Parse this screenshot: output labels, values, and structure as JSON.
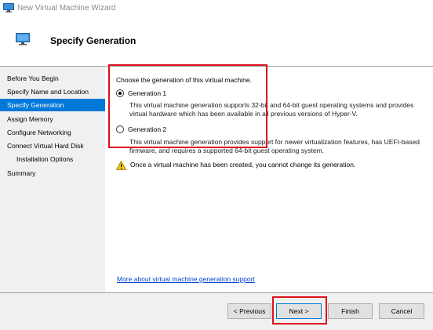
{
  "window": {
    "title": "New Virtual Machine Wizard",
    "icon": "monitor-icon"
  },
  "header": {
    "title": "Specify Generation",
    "icon": "monitor-icon"
  },
  "nav": {
    "items": [
      {
        "label": "Before You Begin",
        "active": false
      },
      {
        "label": "Specify Name and Location",
        "active": false
      },
      {
        "label": "Specify Generation",
        "active": true
      },
      {
        "label": "Assign Memory",
        "active": false
      },
      {
        "label": "Configure Networking",
        "active": false
      },
      {
        "label": "Connect Virtual Hard Disk",
        "active": false
      },
      {
        "label": "Installation Options",
        "active": false,
        "sub": true
      },
      {
        "label": "Summary",
        "active": false
      }
    ]
  },
  "content": {
    "prompt": "Choose the generation of this virtual machine.",
    "options": [
      {
        "label": "Generation 1",
        "selected": true,
        "description": "This virtual machine generation supports 32-bit and 64-bit guest operating systems and provides virtual hardware which has been available in all previous versions of Hyper-V."
      },
      {
        "label": "Generation 2",
        "selected": false,
        "description": "This virtual machine generation provides support for newer virtualization features, has UEFI-based firmware, and requires a supported 64-bit guest operating system."
      }
    ],
    "warning": "Once a virtual machine has been created, you cannot change its generation.",
    "warning_icon": "warning-icon",
    "more_link": "More about virtual machine generation support"
  },
  "footer": {
    "previous": "< Previous",
    "next": "Next >",
    "finish": "Finish",
    "cancel": "Cancel"
  },
  "colors": {
    "accent": "#0078d7",
    "highlight_box": "#e01020",
    "link": "#0044cc"
  }
}
